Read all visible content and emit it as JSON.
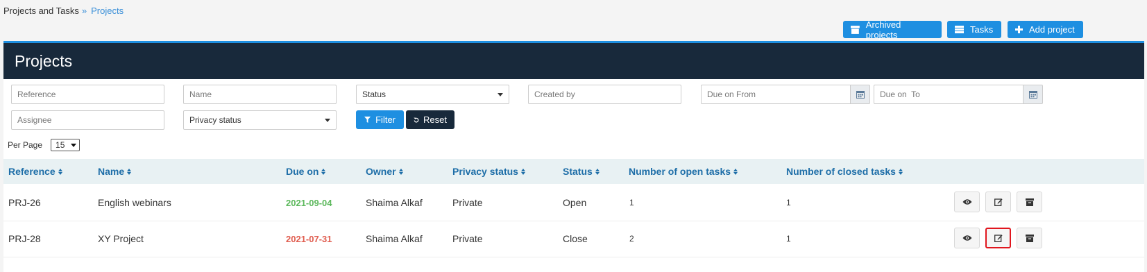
{
  "breadcrumb": {
    "parent": "Projects and Tasks",
    "separator": "»",
    "current": "Projects"
  },
  "top_buttons": {
    "archived": "Archived projects",
    "tasks": "Tasks",
    "add": "Add project"
  },
  "panel": {
    "title": "Projects"
  },
  "filters": {
    "reference_placeholder": "Reference",
    "name_placeholder": "Name",
    "status_selected": "Status",
    "created_by_placeholder": "Created by",
    "due_from_placeholder": "Due on From",
    "due_to_placeholder": "Due on  To",
    "assignee_placeholder": "Assignee",
    "privacy_selected": "Privacy status",
    "filter_label": "Filter",
    "reset_label": "Reset"
  },
  "per_page": {
    "label": "Per Page",
    "value": "15"
  },
  "table": {
    "columns": [
      "Reference",
      "Name",
      "Due on",
      "Owner",
      "Privacy status",
      "Status",
      "Number of open tasks",
      "Number of closed tasks"
    ],
    "rows": [
      {
        "reference": "PRJ-26",
        "name": "English webinars",
        "due_on": "2021-09-04",
        "due_color": "green",
        "owner": "Shaima Alkaf",
        "privacy": "Private",
        "status": "Open",
        "open_tasks": "1",
        "closed_tasks": "1"
      },
      {
        "reference": "PRJ-28",
        "name": "XY Project",
        "due_on": "2021-07-31",
        "due_color": "red",
        "owner": "Shaima Alkaf",
        "privacy": "Private",
        "status": "Close",
        "open_tasks": "2",
        "closed_tasks": "1"
      }
    ]
  },
  "colors": {
    "accent": "#1e8fe1",
    "header_dark": "#18293b",
    "column_header": "#1e6ea8",
    "date_green": "#5cb85c",
    "date_red": "#e05d4f",
    "highlight": "#e0161e"
  }
}
